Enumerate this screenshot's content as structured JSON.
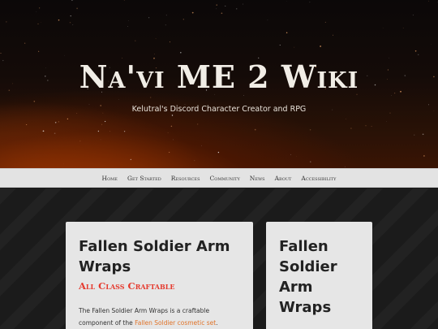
{
  "header": {
    "site_title": "Na'vi ME 2 Wiki",
    "tagline": "Kelutral's Discord Character Creator and RPG"
  },
  "nav": {
    "items": [
      "Home",
      "Get Started",
      "Resources",
      "Community",
      "News",
      "About",
      "Accessibility"
    ]
  },
  "article": {
    "title": "Fallen Soldier Arm Wraps",
    "tag": "All Class Craftable",
    "body_prefix": "The Fallen Soldier Arm Wraps is a craftable component of the ",
    "body_link": "Fallen Soldier cosmetic set",
    "body_suffix": "."
  },
  "sidebar": {
    "title": "Fallen Soldier Arm Wraps"
  },
  "colors": {
    "accent_red": "#e53a2e",
    "link_orange": "#e0742a",
    "nav_bg": "#e3e3e3",
    "card_bg": "#e6e6e6"
  }
}
